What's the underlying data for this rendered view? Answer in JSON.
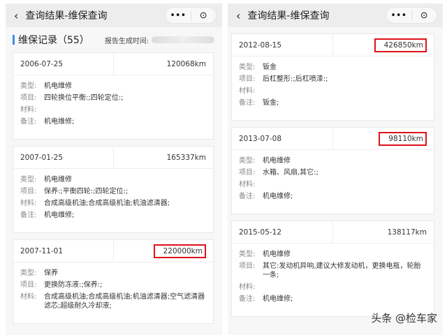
{
  "header": {
    "title": "查询结果-维保查询",
    "back": "‹",
    "more": "•••",
    "target": "⊙"
  },
  "section": {
    "title": "维保记录（55）",
    "generated_label": "报告生成时间:"
  },
  "labels": {
    "type": "类型:",
    "items": "项目:",
    "materials": "材料:",
    "remarks": "备注:"
  },
  "left_records": [
    {
      "date": "2006-07-25",
      "km": "120068km",
      "highlight": false,
      "type": "机电维修",
      "items": "四轮换位平衡:;四轮定位:;",
      "materials": "",
      "remarks": "机电维修;"
    },
    {
      "date": "2007-01-25",
      "km": "165337km",
      "highlight": false,
      "type": "机电维修",
      "items": "保养:;平衡四轮:;四轮定位:;",
      "materials": "合成高级机油;合成高级机油;机油滤清器;",
      "remarks": "机电维修;"
    },
    {
      "date": "2007-11-01",
      "km": "220000km",
      "highlight": true,
      "type": "保养",
      "items": "更换防冻液:;保养:;",
      "materials": "合成高级机油;合成高级机油;机油滤清器;空气滤清器滤芯;超级耐久冷却液;",
      "remarks": null
    }
  ],
  "right_records": [
    {
      "date": "2012-08-15",
      "km": "426850km",
      "highlight": true,
      "type": "钣金",
      "items": "后杠整形:;后杠喷漆:;",
      "materials": "",
      "remarks": "钣金;"
    },
    {
      "date": "2013-07-08",
      "km": "98110km",
      "highlight": true,
      "type": "机电维修",
      "items": "水箱、风扇,其它:;",
      "materials": "",
      "remarks": "机电维修;"
    },
    {
      "date": "2015-05-12",
      "km": "138117km",
      "highlight": false,
      "type": "机电维修",
      "items": "其它:发动机异响,建议大修发动机，更换电瓶，轮胎一条;",
      "materials": "",
      "remarks": "机电维修;"
    }
  ],
  "watermark": "头条 @检车家",
  "colors": {
    "accent": "#3c8cf0",
    "highlight": "#e0101a"
  }
}
